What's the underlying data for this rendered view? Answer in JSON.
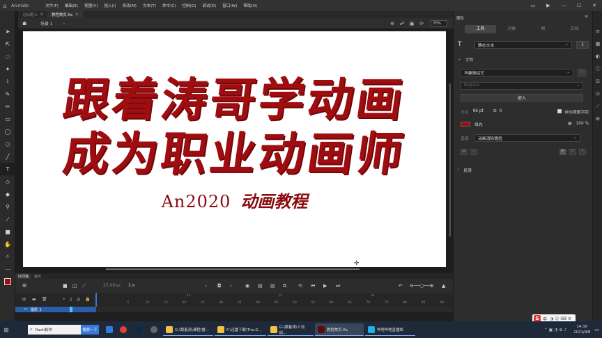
{
  "app": {
    "name": "Animate",
    "menus": [
      "文件(F)",
      "编辑(E)",
      "视图(V)",
      "插入(I)",
      "修改(M)",
      "文本(T)",
      "命令(C)",
      "控制(O)",
      "调试(D)",
      "窗口(W)",
      "帮助(H)"
    ]
  },
  "doc_tabs": [
    {
      "label": "无标题-1",
      "active": false
    },
    {
      "label": "教程首页.fla",
      "active": true
    }
  ],
  "scene": {
    "label": "场景 1",
    "zoom": "70%"
  },
  "stage": {
    "line1": "跟着涛哥学动画",
    "line2": "成为职业动画师",
    "sub_en": "An2020",
    "sub_zh": "动画教程",
    "text_color": "#a00d10"
  },
  "timeline": {
    "tabs": [
      "时间轴",
      "输出"
    ],
    "fps": "25.00",
    "fps_unit": "fps",
    "frame": "1",
    "frame_unit": "帧",
    "layer_name": "图层_1",
    "ruler": [
      "1s",
      "2s",
      "3s"
    ],
    "frame_numbers": [
      "5",
      "10",
      "15",
      "20",
      "25",
      "30",
      "35",
      "40",
      "45",
      "50",
      "55",
      "60",
      "65",
      "70",
      "75",
      "80",
      "85",
      "90"
    ]
  },
  "properties": {
    "panel_title": "属性",
    "tabs": [
      "工具",
      "对象",
      "帧",
      "文档"
    ],
    "text_type": "静态文本",
    "section_char": "字符",
    "font": "华康简综艺",
    "style": "Regular",
    "embed_button": "嵌入",
    "size_label": "大小",
    "size_value": "96 pt",
    "tracking": "0",
    "auto_kern": "自动调整字距",
    "fill_label": "填充",
    "fill_color": "#a00d10",
    "opacity": "100 %",
    "render_label": "呈现",
    "render_value": "动画消除锯齿",
    "section_para": "段落"
  },
  "taskbar": {
    "search_text": "flash制作",
    "search_button": "搜索一下",
    "apps": [
      {
        "label": "G:\\跟着涛\\课程\\播...",
        "active": false
      },
      {
        "label": "F:\\迅雷下载\\The.G...",
        "active": false
      },
      {
        "label": "G:\\跟着涛\\人设組...",
        "active": false
      },
      {
        "label": "教程首页.fla",
        "active": true
      },
      {
        "label": "哔哩哔哩直播姬",
        "active": false
      }
    ],
    "time": "14:30",
    "date": "2021/9/8",
    "ime_mode": "中"
  }
}
